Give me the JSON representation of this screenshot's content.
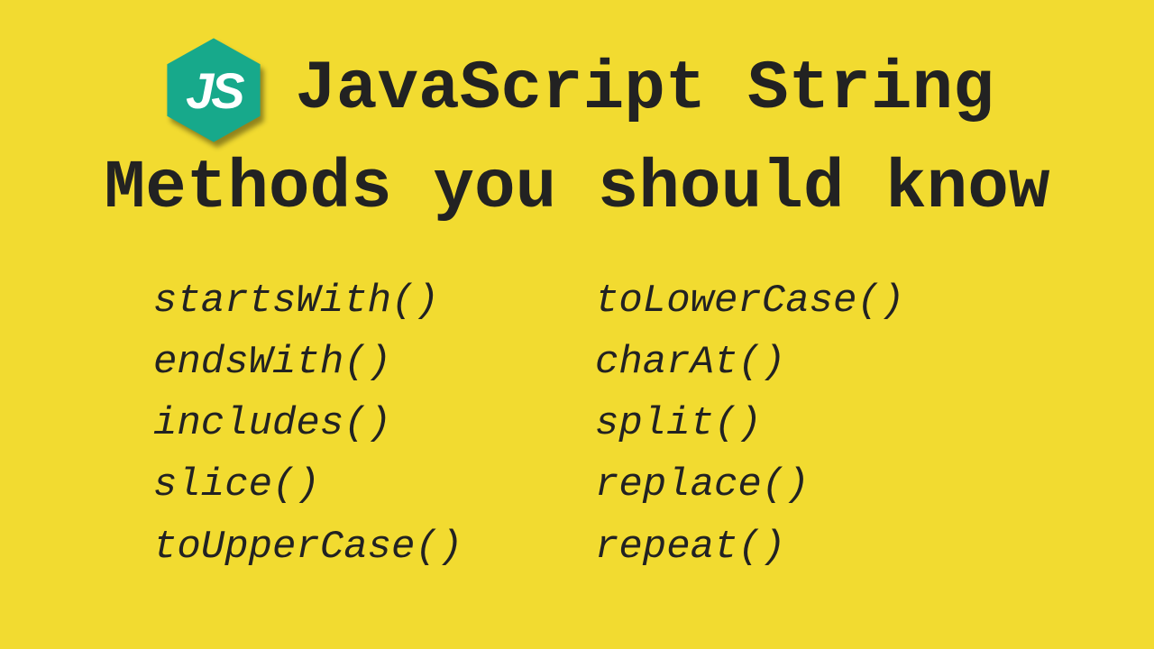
{
  "logo": {
    "text": "JS",
    "color": "#17a98b"
  },
  "title": {
    "line1": "JavaScript String",
    "line2": "Methods you should know"
  },
  "columns": {
    "left": [
      "startsWith()",
      "endsWith()",
      "includes()",
      "slice()",
      "toUpperCase()"
    ],
    "right": [
      "toLowerCase()",
      "charAt()",
      "split()",
      "replace()",
      "repeat()"
    ]
  }
}
